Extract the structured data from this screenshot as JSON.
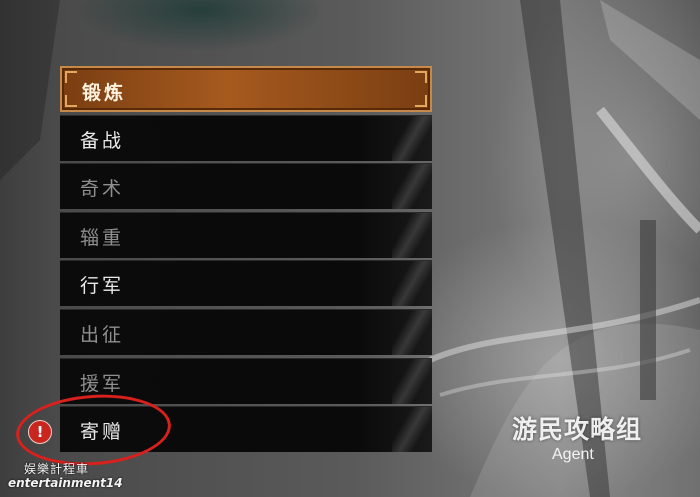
{
  "menu": {
    "items": [
      {
        "label": "锻炼",
        "state": "selected"
      },
      {
        "label": "备战",
        "state": "enabled"
      },
      {
        "label": "奇术",
        "state": "disabled"
      },
      {
        "label": "辎重",
        "state": "disabled"
      },
      {
        "label": "行军",
        "state": "enabled"
      },
      {
        "label": "出征",
        "state": "disabled"
      },
      {
        "label": "援军",
        "state": "disabled"
      },
      {
        "label": "寄赠",
        "state": "enabled",
        "notification": true
      }
    ]
  },
  "alert": {
    "glyph": "!",
    "icon": "alert-icon",
    "color": "#c8261f"
  },
  "annotation": {
    "color": "#d8201c"
  },
  "watermarks": {
    "corner_cn": "娱樂計程車",
    "corner_en": "entertainment14",
    "group": "游民攻略组",
    "agent": "Agent"
  },
  "colors": {
    "selected_fill": "#a65a1e",
    "selected_border": "#c58a4a",
    "item_fill": "#0b0b0b",
    "text_enabled": "#e8e8e8",
    "text_disabled": "#8f8f8f"
  }
}
